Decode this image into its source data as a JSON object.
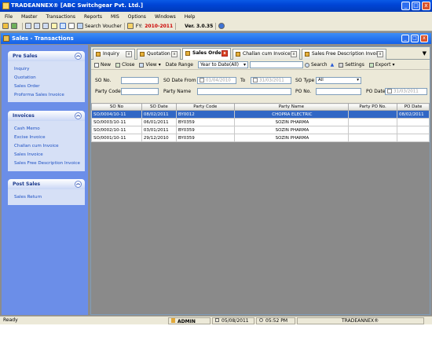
{
  "app": {
    "title": "TRADEANNEX® [ABC Switchgear Pvt. Ltd.]",
    "window_buttons": [
      "_",
      "□",
      "x"
    ]
  },
  "menu": [
    "File",
    "Master",
    "Transactions",
    "Reports",
    "MIS",
    "Options",
    "Windows",
    "Help"
  ],
  "toolbar": {
    "search_voucher": "Search Voucher",
    "fy_label": "FY:",
    "fy_value": "2010-2011",
    "version": "Ver. 3.0.35"
  },
  "child_window": {
    "title": "Sales - Transactions"
  },
  "left_panels": [
    {
      "title": "Pre Sales",
      "items": [
        "Inquiry",
        "Quotation",
        "Sales Order",
        "Proforma Sales Invoice"
      ]
    },
    {
      "title": "Invoices",
      "items": [
        "Cash Memo",
        "Excise Invoice",
        "Challan cum Invoice",
        "Sales Invoice",
        "Sales Free Description Invoice"
      ]
    },
    {
      "title": "Post Sales",
      "items": [
        "Sales Return"
      ]
    }
  ],
  "tabs": [
    "Inquiry",
    "Quotation",
    "Sales Order",
    "Challan cum Invoice",
    "Sales Free Description Invoi..."
  ],
  "active_tab": "Sales Order",
  "subtoolbar": {
    "new": "New",
    "close": "Close",
    "view": "View",
    "date_range_label": "Date Range",
    "date_range_value": "Year to Date(All)",
    "search": "Search",
    "settings": "Settings",
    "export": "Export"
  },
  "filters": {
    "so_no": "SO No.",
    "so_date_from": "SO Date From",
    "date_from": "01/04/2010",
    "to": "To",
    "date_to": "31/03/2011",
    "so_type": "SO Type",
    "so_type_value": "All",
    "party_code": "Party Code",
    "party_name": "Party Name",
    "po_no": "PO No.",
    "po_date": "PO Date",
    "po_date_value": "31/03/2011"
  },
  "grid": {
    "columns": [
      "SO No",
      "SO Date",
      "Party Code",
      "Party Name",
      "Party PO No.",
      "PO Date"
    ],
    "rows": [
      [
        "SO/0004/10-11",
        "08/02/2011",
        "BY0012",
        "CHOPRA ELECTRIC",
        "",
        "08/02/2011"
      ],
      [
        "SO/0003/10-11",
        "06/01/2011",
        "BY0359",
        "SOZIN PHARMA",
        "",
        ""
      ],
      [
        "SO/0002/10-11",
        "03/01/2011",
        "BY0359",
        "SOZIN PHARMA",
        "",
        ""
      ],
      [
        "SO/0001/10-11",
        "29/12/2010",
        "BY0359",
        "SOZIN PHARMA",
        "",
        ""
      ]
    ]
  },
  "status": {
    "ready": "Ready",
    "user": "ADMIN",
    "date": "05/08/2011",
    "time": "05:52 PM",
    "brand": "TRADEANNEX®"
  }
}
